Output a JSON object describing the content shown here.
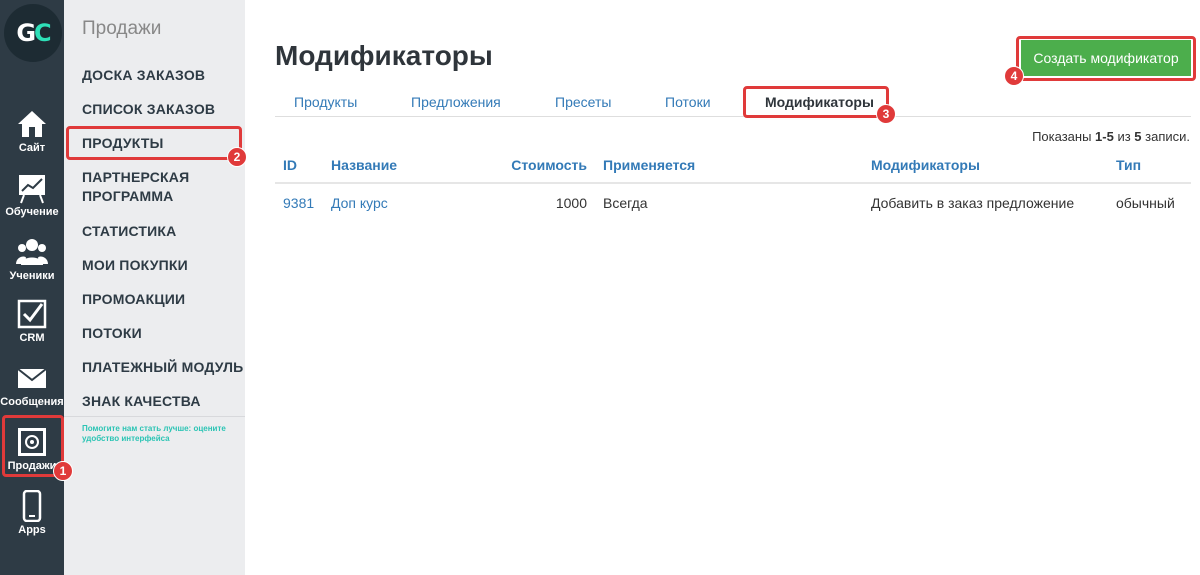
{
  "logo": {
    "g": "G",
    "c": "C"
  },
  "rail": [
    {
      "label": "Сайт",
      "icon": "home-icon"
    },
    {
      "label": "Обучение",
      "icon": "chart-easel-icon"
    },
    {
      "label": "Ученики",
      "icon": "users-icon"
    },
    {
      "label": "CRM",
      "icon": "checkbox-icon"
    },
    {
      "label": "Сообщения",
      "icon": "envelope-icon"
    },
    {
      "label": "Продажи",
      "icon": "safe-icon"
    },
    {
      "label": "Apps",
      "icon": "smartphone-icon"
    }
  ],
  "menu": {
    "title": "Продажи",
    "items": [
      "ДОСКА ЗАКАЗОВ",
      "СПИСОК ЗАКАЗОВ",
      "ПРОДУКТЫ",
      "ПАРТНЕРСКАЯ ПРОГРАММА",
      "СТАТИСТИКА",
      "МОИ ПОКУПКИ",
      "ПРОМОАКЦИИ",
      "ПОТОКИ",
      "ПЛАТЕЖНЫЙ МОДУЛЬ",
      "ЗНАК КАЧЕСТВА"
    ],
    "feedback": "Помогите нам стать лучше: оцените удобство интерфейса"
  },
  "page": {
    "title": "Модификаторы",
    "create_button": "Создать модификатор",
    "tabs": [
      "Продукты",
      "Предложения",
      "Пресеты",
      "Потоки",
      "Модификаторы"
    ],
    "summary": {
      "prefix": "Показаны ",
      "range": "1-5",
      "mid": " из ",
      "total": "5",
      "suffix": " записи."
    }
  },
  "table": {
    "headers": [
      "ID",
      "Название",
      "Стоимость",
      "Применяется",
      "Модификаторы",
      "Тип"
    ],
    "rows": [
      [
        "9381",
        "Доп курс",
        "1000",
        "Всегда",
        "Добавить в заказ предложение",
        "обычный"
      ]
    ]
  },
  "annotations": [
    "1",
    "2",
    "3",
    "4"
  ],
  "colors": {
    "rail": "#2e3b45",
    "menu": "#ecedef",
    "accent": "#337ab7",
    "button": "#4cae4c",
    "highlight": "#e03a3a"
  }
}
